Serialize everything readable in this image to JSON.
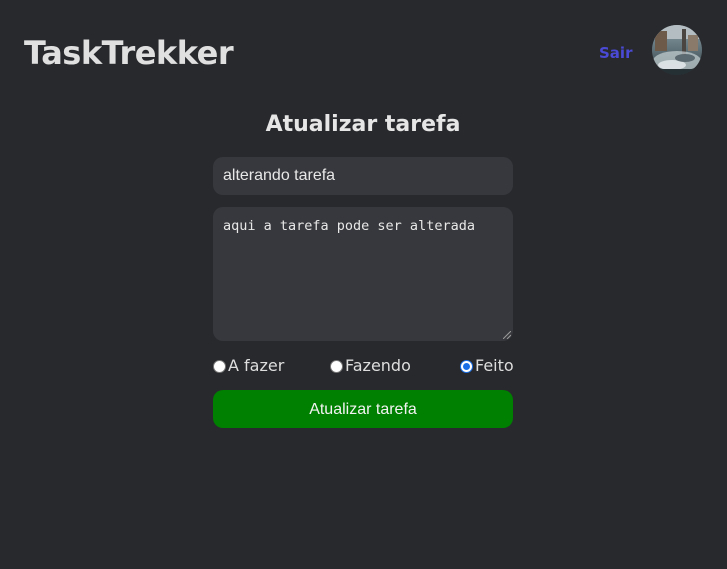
{
  "header": {
    "app_name": "TaskTrekker",
    "signout_label": "Sair",
    "avatar": "user-avatar-photo",
    "signout_color": "#4a4ad6"
  },
  "form": {
    "title": "Atualizar tarefa",
    "task_title_value": "alterando tarefa",
    "task_description_value": "aqui a tarefa pode ser alterada",
    "status_options": [
      {
        "label": "A fazer",
        "checked": false
      },
      {
        "label": "Fazendo",
        "checked": false
      },
      {
        "label": "Feito",
        "checked": true
      }
    ],
    "submit_label": "Atualizar tarefa",
    "submit_color": "#008000"
  },
  "colors": {
    "background": "#28292d",
    "field_background": "#37383d",
    "radio_accent": "#1a6fe6"
  }
}
